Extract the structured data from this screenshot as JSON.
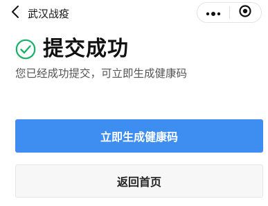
{
  "navbar": {
    "back_icon": "chevron-left-icon",
    "title": "武汉战疫",
    "more_icon": "more-dots-icon",
    "close_icon": "target-circle-icon"
  },
  "result": {
    "status_icon": "check-circle-icon",
    "title": "提交成功",
    "message": "您已经成功提交，可立即生成健康码"
  },
  "actions": {
    "primary_label": "立即生成健康码",
    "secondary_label": "返回首页"
  },
  "colors": {
    "accent": "#3d8ef0",
    "success": "#17b26a"
  }
}
